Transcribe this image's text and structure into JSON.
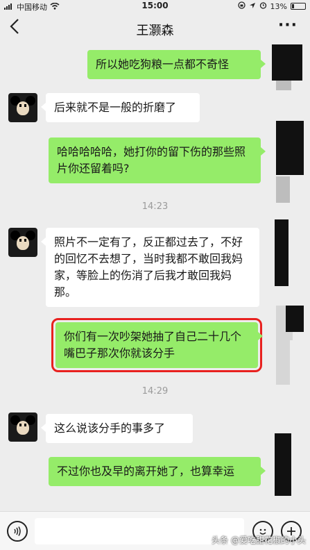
{
  "status_bar": {
    "carrier": "中国移动",
    "time": "15:00",
    "battery": "13%"
  },
  "header": {
    "title": "王灏森",
    "more_label": "···"
  },
  "messages": [
    {
      "side": "right",
      "text": "所以她吃狗粮一点都不奇怪"
    },
    {
      "side": "left",
      "text": "后来就不是一般的折磨了"
    },
    {
      "side": "right",
      "text": "哈哈哈哈哈，她打你的留下伤的那些照片你还留着吗?"
    },
    {
      "side": "left",
      "text": "照片不一定有了，反正都过去了，不好的回忆不去想了，当时我都不敢回我妈家，等脸上的伤消了后我才敢回我妈那。"
    },
    {
      "side": "right",
      "text": "你们有一次吵架她抽了自己二十几个嘴巴子那次你就该分手",
      "highlighted": true
    },
    {
      "side": "left",
      "text": "这么说该分手的事多了"
    },
    {
      "side": "right",
      "text": "不过你也及早的离开她了，也算幸运"
    }
  ],
  "timestamps": [
    "14:23",
    "14:29"
  ],
  "watermark": "头条 @爱吃甜花椒的小头",
  "colors": {
    "background": "#ededed",
    "my_bubble": "#95ec69",
    "their_bubble": "#ffffff",
    "highlight": "#e8211f"
  }
}
